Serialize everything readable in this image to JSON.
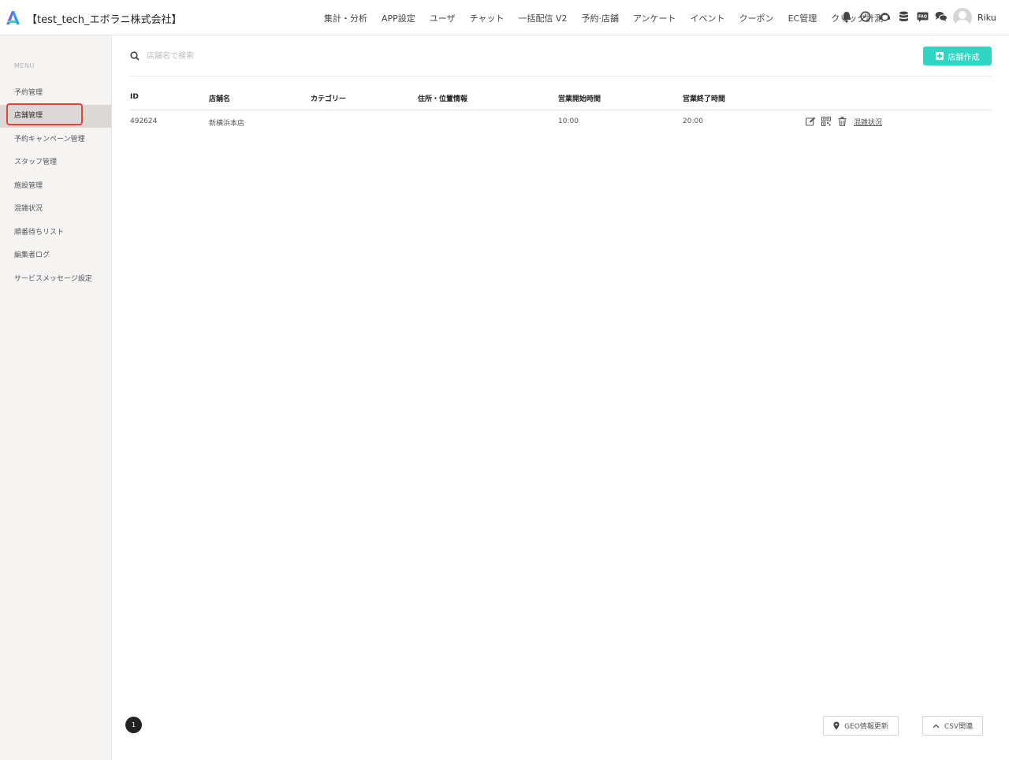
{
  "header": {
    "company": "【test_tech_エボラニ株式会社】",
    "nav": [
      "集計・分析",
      "APP設定",
      "ユーザ",
      "チャット",
      "一括配信 V2",
      "予約·店舗",
      "アンケート",
      "イベント",
      "クーポン",
      "EC管理",
      "クリック計測"
    ],
    "icons": [
      "bell-icon",
      "clock-icon",
      "support-icon",
      "database-icon",
      "faq-icon",
      "chat-icon"
    ],
    "faq_label": "FAQ",
    "username": "Riku"
  },
  "sidebar": {
    "menu_label": "MENU",
    "items": [
      "予約管理",
      "店舗管理",
      "予約キャンペーン管理",
      "スタッフ管理",
      "施設管理",
      "混雑状況",
      "順番待ちリスト",
      "編集者ログ",
      "サービスメッセージ設定"
    ],
    "active_index": 1
  },
  "search": {
    "placeholder": "店舗名で検索",
    "value": ""
  },
  "create_button": "店舗作成",
  "table": {
    "headers": [
      "ID",
      "店舗名",
      "カテゴリー",
      "住所・位置情報",
      "営業開始時間",
      "営業終了時間"
    ],
    "rows": [
      {
        "id": "492624",
        "name": "新横浜本店",
        "category": "",
        "address": "",
        "open": "10:00",
        "close": "20:00",
        "status_link": "混雑状況"
      }
    ]
  },
  "pagination": {
    "current": "1"
  },
  "footer": {
    "geo_button": "GEO情報更新",
    "csv_button": "CSV関連"
  },
  "colors": {
    "accent": "#2fd6c3",
    "highlight": "#e0443c",
    "sidebar_bg": "#f5f4f3",
    "active_bg": "#dbd8d5"
  }
}
